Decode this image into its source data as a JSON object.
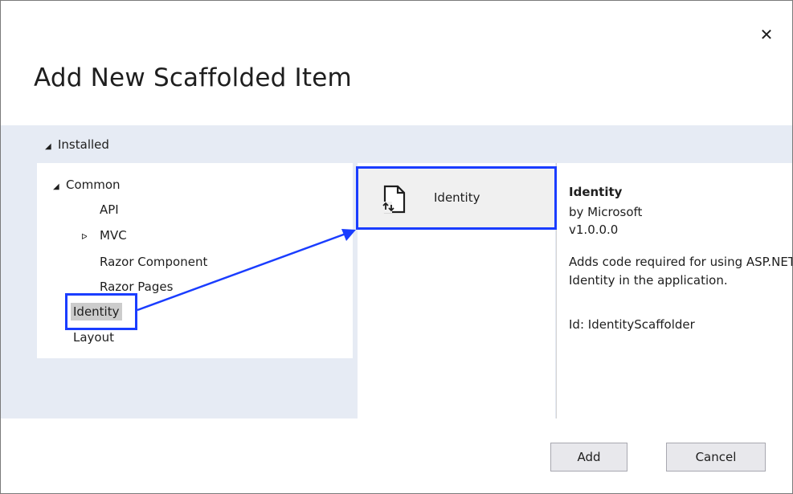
{
  "dialog": {
    "title": "Add New Scaffolded Item",
    "close_glyph": "✕"
  },
  "installed": {
    "label": "Installed",
    "arrow_glyph": "◢"
  },
  "tree": {
    "common": {
      "label": "Common",
      "arrow_glyph": "◢"
    },
    "api": {
      "label": "API"
    },
    "mvc": {
      "label": "MVC",
      "arrow_glyph": "ᐅ"
    },
    "razor_component": {
      "label": "Razor Component"
    },
    "razor_pages": {
      "label": "Razor Pages"
    },
    "identity": {
      "label": "Identity"
    },
    "layout": {
      "label": "Layout"
    }
  },
  "item": {
    "label": "Identity",
    "icon": "scaffold-file-icon"
  },
  "details": {
    "title": "Identity",
    "author": "by Microsoft",
    "version": "v1.0.0.0",
    "description_line1": "Adds code required for using ASP.NET Core",
    "description_line2": "Identity in the application.",
    "id": "Id: IdentityScaffolder"
  },
  "buttons": {
    "add": "Add",
    "cancel": "Cancel"
  },
  "colors": {
    "highlight": "#1a3dff",
    "band": "#e6ebf4",
    "selected": "#cccccc"
  }
}
